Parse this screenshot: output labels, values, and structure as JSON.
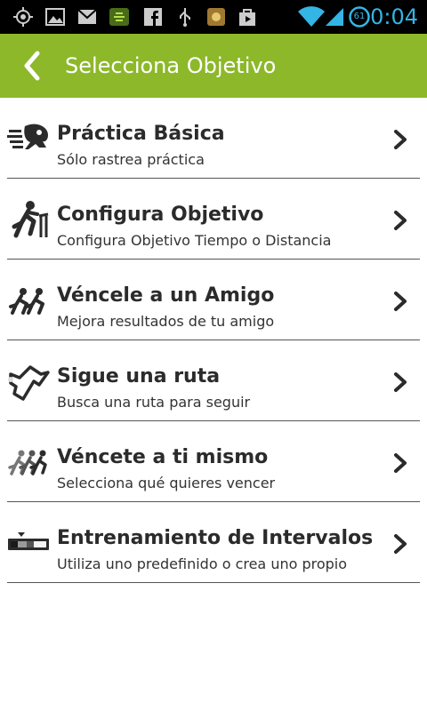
{
  "status_bar": {
    "time": "0:04",
    "battery_level": "61",
    "icons": [
      "gps-icon",
      "gallery-icon",
      "gmail-icon",
      "app-notification-icon",
      "facebook-icon",
      "usb-icon",
      "app-icon",
      "play-store-icon",
      "wifi-icon",
      "signal-icon",
      "battery-icon"
    ]
  },
  "action_bar": {
    "title": "Selecciona Objetivo",
    "color": "#8cb82a",
    "back_icon": "back-chevron-icon"
  },
  "options": [
    {
      "title": "Práctica Básica",
      "subtitle": "Sólo rastrea práctica",
      "icon": "runner-speed-icon"
    },
    {
      "title": "Configura Objetivo",
      "subtitle": "Configura Objetivo Tiempo o Distancia",
      "icon": "runner-flag-icon"
    },
    {
      "title": "Véncele a un Amigo",
      "subtitle": "Mejora resultados de tu amigo",
      "icon": "two-runners-icon"
    },
    {
      "title": "Sigue una ruta",
      "subtitle": "Busca una ruta para seguir",
      "icon": "route-icon"
    },
    {
      "title": "Véncete a ti mismo",
      "subtitle": "Selecciona qué quieres vencer",
      "icon": "three-runners-icon"
    },
    {
      "title": "Entrenamiento de Intervalos",
      "subtitle": "Utiliza uno predefinido o crea uno propio",
      "icon": "intervals-icon"
    }
  ]
}
